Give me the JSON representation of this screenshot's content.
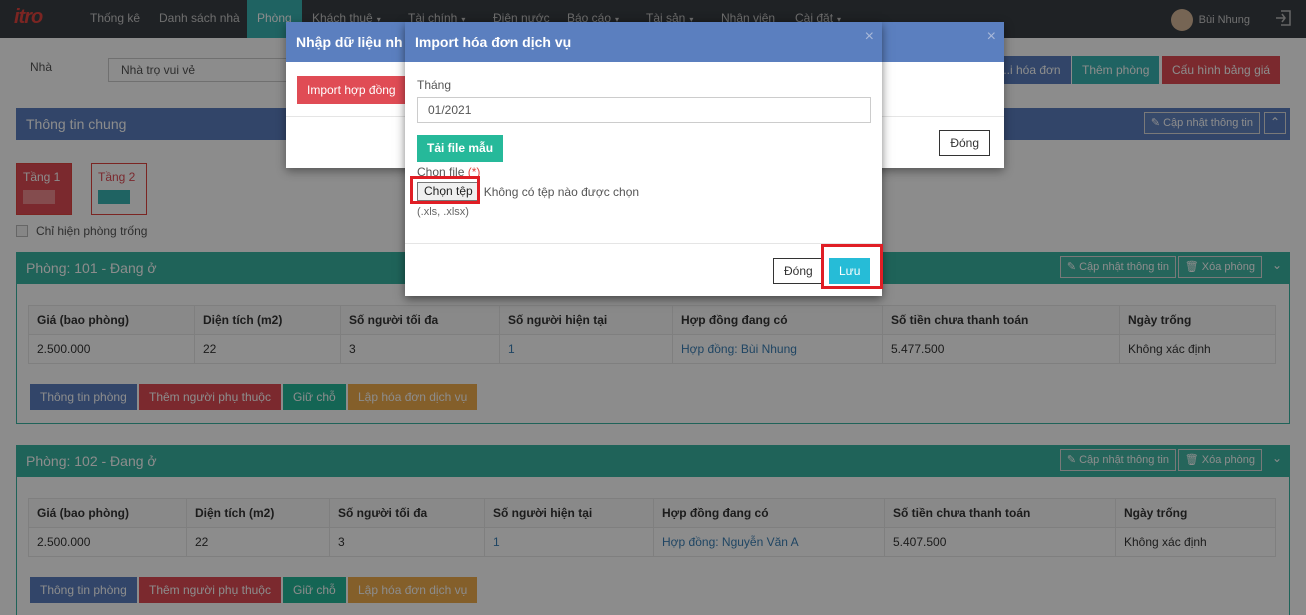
{
  "nav": {
    "logo": "itro",
    "items": [
      "Thống kê",
      "Danh sách nhà",
      "Phòng",
      "Khách thuê",
      "Tài chính",
      "Điện nước",
      "Báo cáo",
      "Tài sản",
      "Nhân viên",
      "Cài đặt"
    ],
    "user": "Bùi Nhung"
  },
  "filter": {
    "label": "Nhà",
    "value": "Nhà trọ vui vẻ"
  },
  "top_buttons": {
    "invoice": "...i hóa đơn",
    "add_room": "Thêm phòng",
    "price_config": "Cấu hình bảng giá"
  },
  "general": {
    "title": "Thông tin chung",
    "update": "Cập nhật thông tin"
  },
  "floors": [
    "Tầng 1",
    "Tầng 2"
  ],
  "empty_only": "Chỉ hiện phòng trống",
  "rooms": [
    {
      "title": "Phòng: 101 - Đang ở",
      "update": "Cập nhật thông tin",
      "delete": "Xóa phòng",
      "headers": [
        "Giá (bao phòng)",
        "Diện tích (m2)",
        "Số người tối đa",
        "Số người hiện tại",
        "Hợp đồng đang có",
        "Số tiền chưa thanh toán",
        "Ngày trống"
      ],
      "cells": [
        "2.500.000",
        "22",
        "3",
        "1",
        "Hợp đồng: Bùi Nhung",
        "5.477.500",
        "Không xác định"
      ],
      "actions": [
        "Thông tin phòng",
        "Thêm người phụ thuộc",
        "Giữ chỗ",
        "Lập hóa đơn dịch vụ"
      ]
    },
    {
      "title": "Phòng: 102 - Đang ở",
      "update": "Cập nhật thông tin",
      "delete": "Xóa phòng",
      "headers": [
        "Giá (bao phòng)",
        "Diện tích (m2)",
        "Số người tối đa",
        "Số người hiện tại",
        "Hợp đồng đang có",
        "Số tiền chưa thanh toán",
        "Ngày trống"
      ],
      "cells": [
        "2.500.000",
        "22",
        "3",
        "1",
        "Hợp đồng: Nguyễn Văn A",
        "5.407.500",
        "Không xác định"
      ],
      "actions": [
        "Thông tin phòng",
        "Thêm người phụ thuộc",
        "Giữ chỗ",
        "Lập hóa đơn dịch vụ"
      ]
    }
  ],
  "modal_back": {
    "title": "Nhập dữ liệu nh",
    "import_contract": "Import hợp đồng",
    "close": "Đóng"
  },
  "modal_front": {
    "title": "Import hóa đơn dịch vụ",
    "month_label": "Tháng",
    "month_value": "01/2021",
    "download_template": "Tải file mẫu",
    "file_label": "Chọn file",
    "required_mark": "(*)",
    "choose_button": "Chọn tệp",
    "no_file": "Không có tệp nào được chọn",
    "extensions": "(.xls, .xlsx)",
    "close": "Đóng",
    "save": "Lưu"
  },
  "colors": {
    "nav_bg": "#3a3f44",
    "accent": "#3ab5b2",
    "modal_header": "#5b7fbf",
    "save": "#26bcd7",
    "highlight": "#e01e25"
  }
}
